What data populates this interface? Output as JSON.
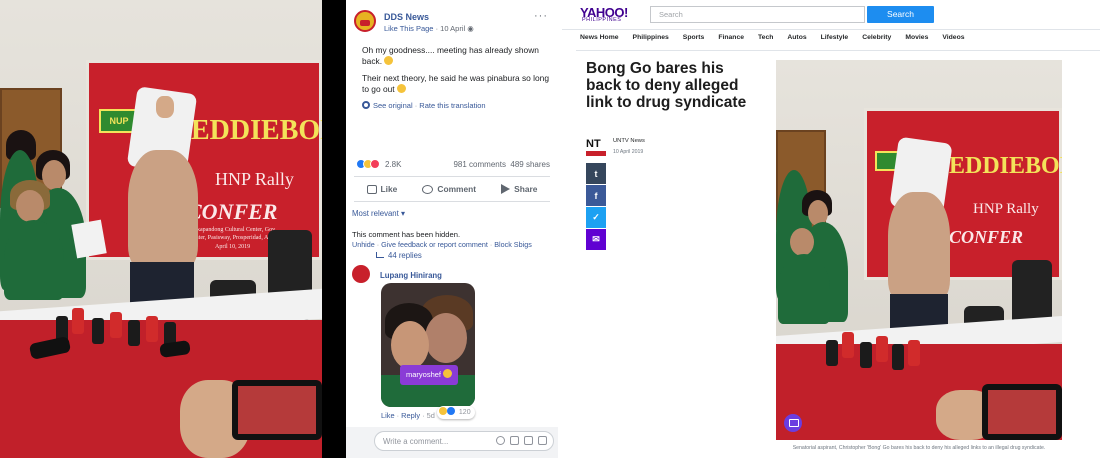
{
  "left_photo": {
    "banner_title": "EDDIEBON",
    "banner_sub1": "HNP Rally",
    "banner_sub2": "CONFER",
    "banner_venue": "Makapandong Cultural Center, Gov.",
    "banner_venue2": "Center, Pasisway, Prosperidad, Ag.",
    "banner_date": "April 10, 2019",
    "logo_text": "NUP"
  },
  "facebook": {
    "page_name": "DDS News",
    "like_page": "Like This Page",
    "date": "10 April",
    "more": "···",
    "post_line1": "Oh my goodness.... meeting has already shown back.",
    "post_line2": "Their next theory, he said he was pinabura so long to go out",
    "see_original": "See original",
    "rate_translation": "Rate this translation",
    "reaction_count": "2.8K",
    "comments_count": "981 comments",
    "shares_count": "489 shares",
    "like_label": "Like",
    "comment_label": "Comment",
    "share_label": "Share",
    "sort_label": "Most relevant",
    "hidden_text": "This comment has been hidden.",
    "unhide": "Unhide",
    "give_feedback": "Give feedback or report comment",
    "block": "Block Sbigs",
    "replies": "44 replies",
    "commenter": "Lupang Hinirang",
    "sticker_text": "maryoshef",
    "comment_like": "Like",
    "comment_reply": "Reply",
    "comment_age": "5d",
    "comment_reactions": "120",
    "input_placeholder": "Write a comment..."
  },
  "yahoo": {
    "logo": "YAHOO!",
    "logo_region": "PHILIPPINES",
    "search_placeholder": "Search",
    "search_button": "Search",
    "nav": [
      "News Home",
      "Philippines",
      "Sports",
      "Finance",
      "Tech",
      "Autos",
      "Lifestyle",
      "Celebrity",
      "Movies",
      "Videos"
    ],
    "headline": "Bong Go bares his back to deny alleged link to drug syndicate",
    "source_logo": "NT",
    "source_name": "UNTV News",
    "source_date": "10 April 2019",
    "share_icons": [
      "tumblr-icon",
      "facebook-icon",
      "twitter-icon",
      "mail-icon"
    ],
    "share_glyphs": [
      "t",
      "f",
      "✓",
      "✉"
    ],
    "share_colors": [
      "#35465c",
      "#3b5998",
      "#1da1f2",
      "#6001d2"
    ],
    "photo_banner_title": "EDDIEBON",
    "photo_banner_sub1": "HNP Rally",
    "photo_banner_sub2": "CONFER",
    "caption": "Senatorial aspirant, Christopher 'Bong' Go bares his back to deny his alleged links to an illegal drug syndicate."
  }
}
